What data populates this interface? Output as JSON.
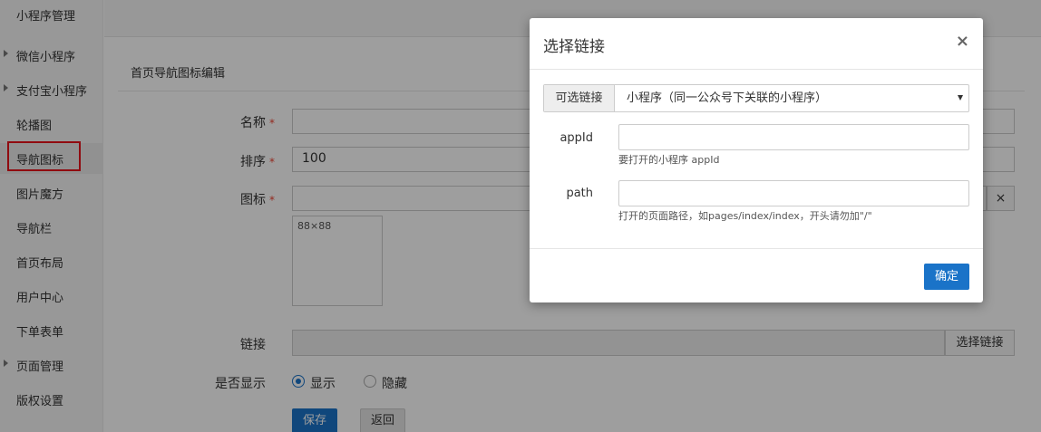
{
  "sidebar": {
    "title": "小程序管理",
    "items": [
      {
        "label": "微信小程序",
        "expandable": true
      },
      {
        "label": "支付宝小程序",
        "expandable": true
      },
      {
        "label": "轮播图",
        "expandable": false
      },
      {
        "label": "导航图标",
        "expandable": false,
        "active": true
      },
      {
        "label": "图片魔方",
        "expandable": false
      },
      {
        "label": "导航栏",
        "expandable": false
      },
      {
        "label": "首页布局",
        "expandable": false
      },
      {
        "label": "用户中心",
        "expandable": false
      },
      {
        "label": "下单表单",
        "expandable": false
      },
      {
        "label": "页面管理",
        "expandable": true
      },
      {
        "label": "版权设置",
        "expandable": false
      }
    ]
  },
  "form": {
    "section_title": "首页导航图标编辑",
    "required_mark": "*",
    "name_label": "名称",
    "name_value": "",
    "sort_label": "排序",
    "sort_value": "100",
    "icon_label": "图标",
    "icon_placeholder": "88×88",
    "clear_symbol": "×",
    "link_label": "链接",
    "link_button": "选择链接",
    "display_label": "是否显示",
    "display_options": [
      {
        "label": "显示",
        "selected": true
      },
      {
        "label": "隐藏",
        "selected": false
      }
    ],
    "save_button": "保存",
    "back_button": "返回"
  },
  "modal": {
    "title": "选择链接",
    "close_symbol": "×",
    "select_addon": "可选链接",
    "select_value": "小程序（同一公众号下关联的小程序）",
    "appid_label": "appId",
    "appid_value": "",
    "appid_help": "要打开的小程序 appId",
    "path_label": "path",
    "path_value": "",
    "path_help": "打开的页面路径，如pages/index/index，开头请勿加\"/\"",
    "ok_button": "确定"
  },
  "colors": {
    "primary": "#1a73c8",
    "highlight_box": "#e8131a",
    "required": "#ee4433"
  }
}
